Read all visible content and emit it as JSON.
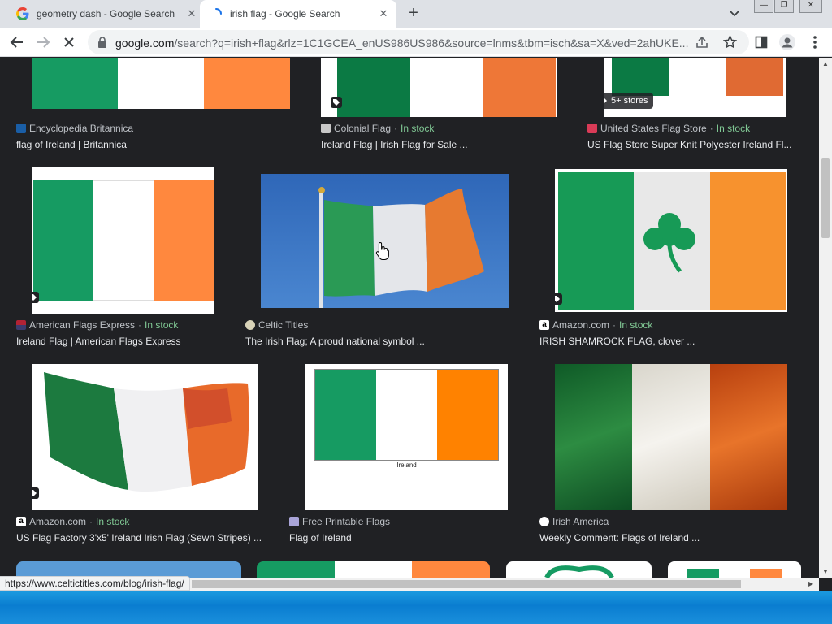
{
  "browser": {
    "tabs": [
      {
        "title": "geometry dash - Google Search",
        "favicon": "google-g-icon",
        "active": false
      },
      {
        "title": "irish flag - Google Search",
        "favicon": "loading-spinner-icon",
        "active": true
      }
    ],
    "address": {
      "host": "google.com",
      "path": "/search?q=irish+flag&rlz=1C1GCEA_enUS986US986&source=lnms&tbm=isch&sa=X&ved=2ahUKE..."
    },
    "status_url": "https://www.celtictitles.com/blog/irish-flag/"
  },
  "results": [
    {
      "source": "Encyclopedia Britannica",
      "stock": "",
      "caption": "flag of Ireland | Britannica"
    },
    {
      "source": "Colonial Flag",
      "stock": "In stock",
      "caption": "Ireland Flag | Irish Flag for Sale ..."
    },
    {
      "source": "United States Flag Store",
      "stock": "In stock",
      "caption": "US Flag Store Super Knit Polyester Ireland Fl...",
      "badge": "5+ stores"
    },
    {
      "source": "American Flags Express",
      "stock": "In stock",
      "caption": "Ireland Flag | American Flags Express"
    },
    {
      "source": "Celtic Titles",
      "stock": "",
      "caption": "The Irish Flag; A proud national symbol ..."
    },
    {
      "source": "Amazon.com",
      "stock": "In stock",
      "caption": "IRISH SHAMROCK FLAG, clover ..."
    },
    {
      "source": "Amazon.com",
      "stock": "In stock",
      "caption": "US Flag Factory 3'x5' Ireland Irish Flag (Sewn Stripes) ..."
    },
    {
      "source": "Free Printable Flags",
      "stock": "",
      "caption": "Flag of Ireland",
      "image_text": "Ireland"
    },
    {
      "source": "Irish America",
      "stock": "",
      "caption": "Weekly Comment: Flags of Ireland ..."
    }
  ],
  "labels": {
    "dot": "·"
  },
  "colors": {
    "green": "#169b62",
    "white": "#ffffff",
    "orange": "#ff883e",
    "stock": "#81c995"
  }
}
